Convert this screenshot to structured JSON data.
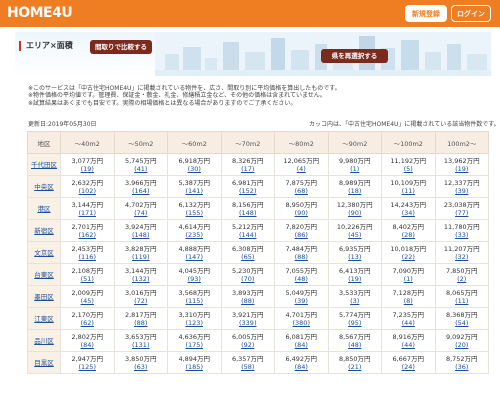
{
  "header": {
    "logo": "HOME4U",
    "register_label": "新規登録",
    "login_label": "ログイン"
  },
  "banner": {
    "title": "エリア×面積",
    "compare_label": "間取りで比較する",
    "reselect_label": "県を再選択する"
  },
  "notes": [
    "※このサービスは「中古住宅HOME4U」に掲載されている物件を、広さ、間取り別に平均価格を算出したものです。",
    "※物件価格の平均値です。管理費、保証金・敷金、礼金、修繕積立金など、その他の価格は含まれていません。",
    "※試算結果はあくまでも目安です。実際の相場価格とは異なる場合がありますのでご了承ください。"
  ],
  "updated": "更新日:2019年05月30日",
  "unit_note": "カッコ内は、「中古住宅HOME4U」に掲載されている該当物件数です。",
  "table": {
    "headers": [
      "地区",
      "～40m2",
      "～50m2",
      "～60m2",
      "～70m2",
      "～80m2",
      "～90m2",
      "～100m2",
      "100m2～"
    ],
    "rows": [
      {
        "area": "千代田区",
        "cells": [
          [
            "3,077万円",
            "(19)"
          ],
          [
            "5,745万円",
            "(41)"
          ],
          [
            "6,918万円",
            "(30)"
          ],
          [
            "8,326万円",
            "(17)"
          ],
          [
            "12,065万円",
            "(4)"
          ],
          [
            "9,980万円",
            "(1)"
          ],
          [
            "11,192万円",
            "(5)"
          ],
          [
            "13,962万円",
            "(19)"
          ]
        ]
      },
      {
        "area": "中央区",
        "cells": [
          [
            "2,632万円",
            "(102)"
          ],
          [
            "3,966万円",
            "(164)"
          ],
          [
            "5,387万円",
            "(141)"
          ],
          [
            "6,981万円",
            "(152)"
          ],
          [
            "7,875万円",
            "(68)"
          ],
          [
            "8,989万円",
            "(18)"
          ],
          [
            "10,109万円",
            "(11)"
          ],
          [
            "12,337万円",
            "(39)"
          ]
        ]
      },
      {
        "area": "港区",
        "cells": [
          [
            "3,144万円",
            "(171)"
          ],
          [
            "4,702万円",
            "(74)"
          ],
          [
            "6,132万円",
            "(155)"
          ],
          [
            "8,156万円",
            "(148)"
          ],
          [
            "8,950万円",
            "(90)"
          ],
          [
            "12,380万円",
            "(90)"
          ],
          [
            "14,243万円",
            "(34)"
          ],
          [
            "23,038万円",
            "(77)"
          ]
        ]
      },
      {
        "area": "新宿区",
        "cells": [
          [
            "2,701万円",
            "(162)"
          ],
          [
            "3,924万円",
            "(148)"
          ],
          [
            "4,614万円",
            "(235)"
          ],
          [
            "5,212万円",
            "(144)"
          ],
          [
            "7,820万円",
            "(86)"
          ],
          [
            "10,226万円",
            "(45)"
          ],
          [
            "8,402万円",
            "(28)"
          ],
          [
            "11,780万円",
            "(33)"
          ]
        ]
      },
      {
        "area": "文京区",
        "cells": [
          [
            "2,453万円",
            "(116)"
          ],
          [
            "3,828万円",
            "(119)"
          ],
          [
            "4,888万円",
            "(147)"
          ],
          [
            "6,308万円",
            "(65)"
          ],
          [
            "7,484万円",
            "(88)"
          ],
          [
            "6,935万円",
            "(13)"
          ],
          [
            "10,018万円",
            "(22)"
          ],
          [
            "11,207万円",
            "(32)"
          ]
        ]
      },
      {
        "area": "台東区",
        "cells": [
          [
            "2,108万円",
            "(51)"
          ],
          [
            "3,144万円",
            "(132)"
          ],
          [
            "4,045万円",
            "(93)"
          ],
          [
            "5,230万円",
            "(70)"
          ],
          [
            "7,055万円",
            "(48)"
          ],
          [
            "6,413万円",
            "(19)"
          ],
          [
            "7,090万円",
            "(1)"
          ],
          [
            "7,850万円",
            "(2)"
          ]
        ]
      },
      {
        "area": "墨田区",
        "cells": [
          [
            "2,009万円",
            "(45)"
          ],
          [
            "3,016万円",
            "(72)"
          ],
          [
            "3,568万円",
            "(115)"
          ],
          [
            "3,893万円",
            "(88)"
          ],
          [
            "5,049万円",
            "(39)"
          ],
          [
            "3,533万円",
            "(3)"
          ],
          [
            "7,128万円",
            "(8)"
          ],
          [
            "8,065万円",
            "(11)"
          ]
        ]
      },
      {
        "area": "江東区",
        "cells": [
          [
            "2,170万円",
            "(62)"
          ],
          [
            "2,817万円",
            "(88)"
          ],
          [
            "3,310万円",
            "(123)"
          ],
          [
            "3,921万円",
            "(339)"
          ],
          [
            "4,701万円",
            "(380)"
          ],
          [
            "5,774万円",
            "(95)"
          ],
          [
            "7,235万円",
            "(44)"
          ],
          [
            "8,368万円",
            "(54)"
          ]
        ]
      },
      {
        "area": "品川区",
        "cells": [
          [
            "2,802万円",
            "(84)"
          ],
          [
            "3,653万円",
            "(131)"
          ],
          [
            "4,636万円",
            "(175)"
          ],
          [
            "6,005万円",
            "(92)"
          ],
          [
            "6,081万円",
            "(84)"
          ],
          [
            "8,567万円",
            "(48)"
          ],
          [
            "8,916万円",
            "(44)"
          ],
          [
            "9,092万円",
            "(20)"
          ]
        ]
      },
      {
        "area": "目黒区",
        "cells": [
          [
            "2,947万円",
            "(125)"
          ],
          [
            "3,850万円",
            "(63)"
          ],
          [
            "4,894万円",
            "(185)"
          ],
          [
            "6,357万円",
            "(58)"
          ],
          [
            "6,492万円",
            "(84)"
          ],
          [
            "8,850万円",
            "(21)"
          ],
          [
            "6,667万円",
            "(24)"
          ],
          [
            "8,752万円",
            "(36)"
          ]
        ]
      }
    ]
  },
  "colors": {
    "header": "#ef7d21",
    "button_dark": "#7b2a1e",
    "link": "#1a4fa0",
    "th_bg": "#f7ede3"
  }
}
